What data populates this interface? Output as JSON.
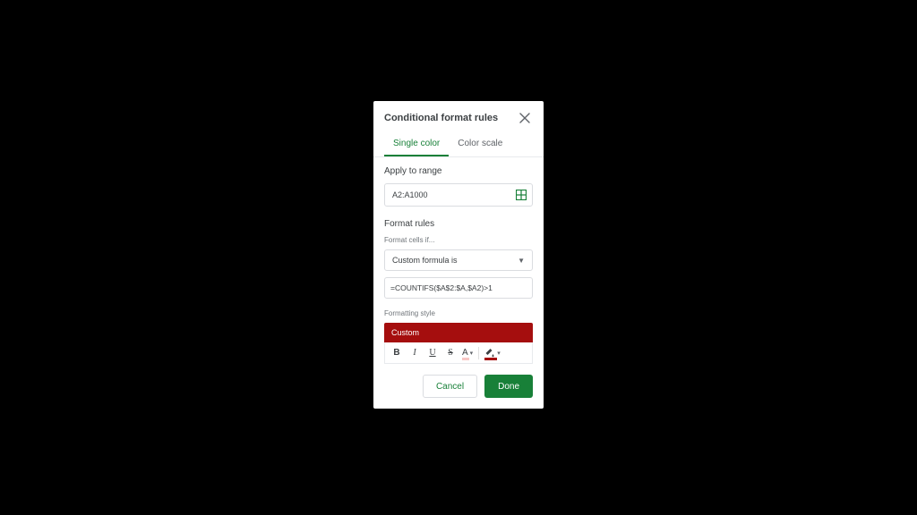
{
  "panel": {
    "title": "Conditional format rules"
  },
  "tabs": {
    "single": "Single color",
    "scale": "Color scale"
  },
  "range": {
    "label": "Apply to range",
    "value": "A2:A1000"
  },
  "rules": {
    "heading": "Format rules",
    "condition_label": "Format cells if...",
    "condition_selected": "Custom formula is",
    "formula_value": "=COUNTIFS($A$2:$A,$A2)>1"
  },
  "style": {
    "label": "Formatting style",
    "preview_text": "Custom",
    "preview_bg": "#a50e0e",
    "text_color_swatch": "#f8c7c5",
    "fill_color_swatch": "#a50e0e"
  },
  "footer": {
    "cancel": "Cancel",
    "done": "Done"
  },
  "colors": {
    "accent": "#188038"
  }
}
